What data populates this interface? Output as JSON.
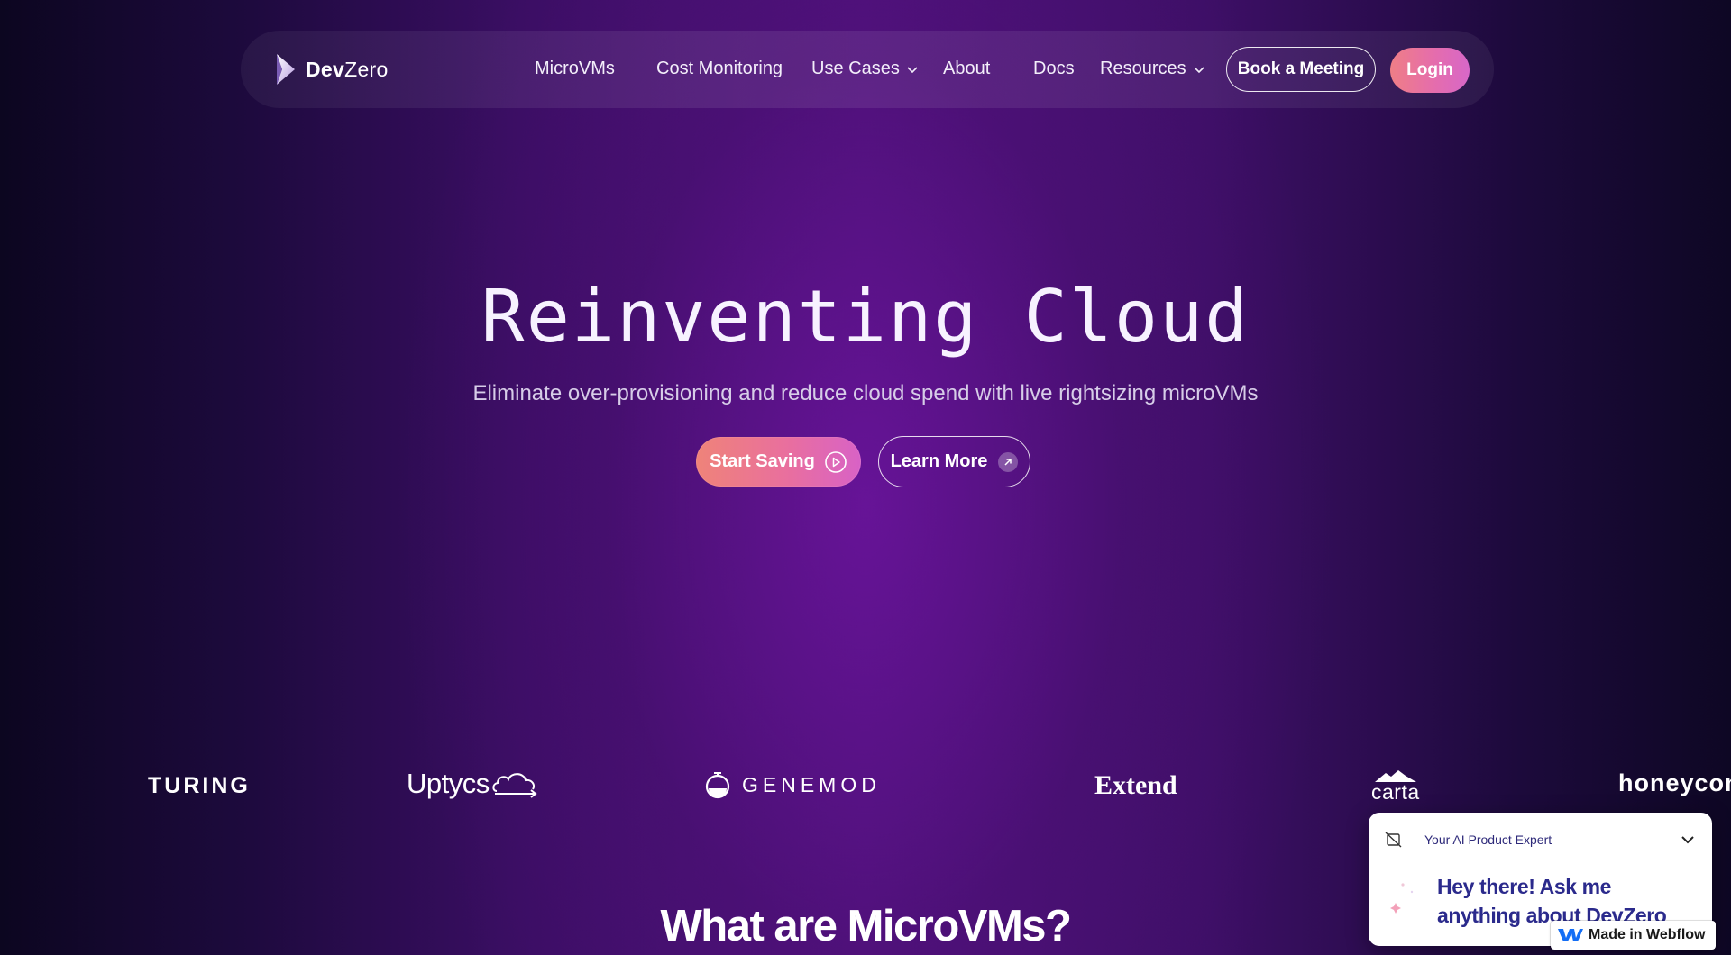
{
  "colors": {
    "accent_gradient_start": "#ef7e86",
    "accent_gradient_end": "#d767c8",
    "background_center": "#4f127c",
    "chat_text": "#2b2a8c"
  },
  "nav": {
    "brand": {
      "bold": "Dev",
      "regular": "Zero",
      "icon": "devzero-logo-icon"
    },
    "items": [
      {
        "label": "MicroVMs"
      },
      {
        "label": "Cost Monitoring"
      },
      {
        "label": "Use Cases",
        "has_dropdown": true
      },
      {
        "label": "About"
      },
      {
        "label": "Docs"
      },
      {
        "label": "Resources",
        "has_dropdown": true
      }
    ],
    "book_meeting_label": "Book a Meeting",
    "login_label": "Login"
  },
  "hero": {
    "title": "Reinventing Cloud",
    "subtitle": "Eliminate over-provisioning and reduce cloud spend with live rightsizing microVMs",
    "start_saving_label": "Start Saving",
    "start_saving_icon": "play-circle-icon",
    "learn_more_label": "Learn More",
    "learn_more_icon": "arrow-up-right-icon"
  },
  "clients": {
    "logos": [
      {
        "name": "TURING"
      },
      {
        "name": "Uptycs"
      },
      {
        "name": "GENEMOD"
      },
      {
        "name": "Extend"
      },
      {
        "name": "carta"
      },
      {
        "name": "honeycomb"
      }
    ]
  },
  "section": {
    "title": "What are MicroVMs?"
  },
  "chat_widget": {
    "header_label": "Your AI Product Expert",
    "message": "Hey there! Ask me anything about DevZero"
  },
  "webflow_badge": {
    "label": "Made in Webflow"
  }
}
